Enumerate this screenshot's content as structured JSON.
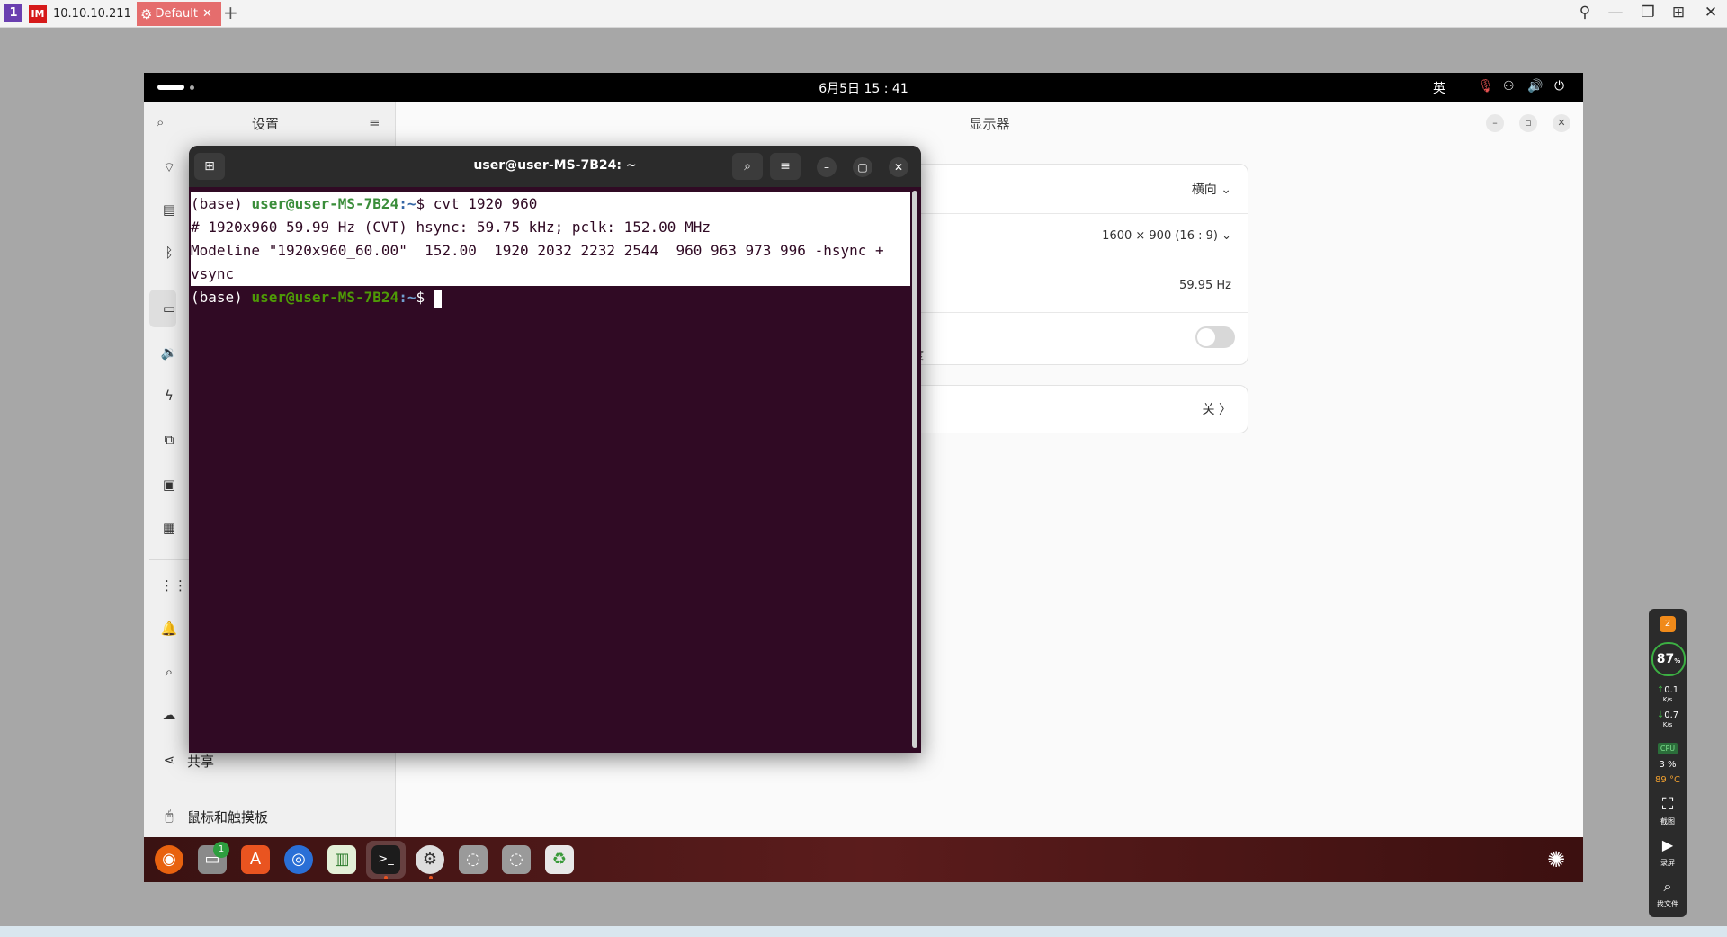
{
  "topbar": {
    "host": "10.10.10.211",
    "tab_label": "Default",
    "host_badge": "IM",
    "plus": "+",
    "logo": "1"
  },
  "gnome": {
    "clock": "6月5日 15 : 41",
    "input_method": "英"
  },
  "settings": {
    "sidebar_title": "设置",
    "share_label": "共享",
    "mouse_label": "鼠标和触摸板",
    "main_title": "显示器",
    "orientation": "横向",
    "resolution": "1600 × 900 (16 : 9)",
    "refresh_rate": "59.95 Hz",
    "partial_text": "晰度",
    "night_light": "关"
  },
  "terminal": {
    "title": "user@user-MS-7B24: ~",
    "prompt_env": "(base) ",
    "prompt_user": "user@user-MS-7B24",
    "prompt_path": ":~",
    "prompt_symbol": "$ ",
    "command": "cvt 1920 960",
    "output1": "# 1920x960 59.99 Hz (CVT) hsync: 59.75 kHz; pclk: 152.00 MHz",
    "output2": "Modeline \"1920x960_60.00\"  152.00  1920 2032 2232 2544  960 963 973 996 -hsync +",
    "output3": "vsync"
  },
  "dock": {
    "files_badge": "1"
  },
  "widget": {
    "badge": "2",
    "percent": "87",
    "percent_unit": "%",
    "up": "0.1",
    "up_unit": "K/s",
    "down": "0.7",
    "down_unit": "K/s",
    "cpu_label": "CPU",
    "cpu_value": "3",
    "cpu_unit": "%",
    "temp": "89 °C",
    "screenshot_label": "截图",
    "record_label": "录屏",
    "search_label": "找文件"
  }
}
